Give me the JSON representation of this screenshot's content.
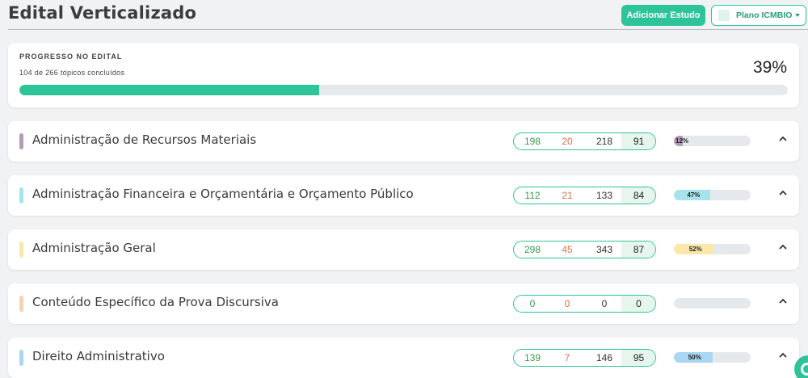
{
  "header": {
    "title": "Edital Verticalizado",
    "add_button": "Adicionar Estudo",
    "plan_button": "Plano ICMBIO"
  },
  "progress": {
    "label": "PROGRESSO NO EDITAL",
    "subtitle": "104 de 266 tópicos concluídos",
    "percent_text": "39%",
    "percent": 39,
    "bar_color": "#2ec49a"
  },
  "subjects": [
    {
      "name": "Administração de Recursos Materiais",
      "color": "#b49bb4",
      "correct": "198",
      "wrong": "20",
      "total": "218",
      "score": "91",
      "progress_text": "12%",
      "progress": 12,
      "bar_color": "#b49bb4"
    },
    {
      "name": "Administração Financeira e Orçamentária e Orçamento Público",
      "color": "#a6e3ec",
      "correct": "112",
      "wrong": "21",
      "total": "133",
      "score": "84",
      "progress_text": "47%",
      "progress": 47,
      "bar_color": "#a6e3ec"
    },
    {
      "name": "Administração Geral",
      "color": "#fbe7a9",
      "correct": "298",
      "wrong": "45",
      "total": "343",
      "score": "87",
      "progress_text": "52%",
      "progress": 52,
      "bar_color": "#fbe7a9"
    },
    {
      "name": "Conteúdo Específico da Prova Discursiva",
      "color": "#f3d2bd",
      "correct": "0",
      "wrong": "0",
      "total": "0",
      "score": "0",
      "progress_text": "",
      "progress": 0,
      "bar_color": "#f3d2bd"
    },
    {
      "name": "Direito Administrativo",
      "color": "#a8d6f3",
      "correct": "139",
      "wrong": "7",
      "total": "146",
      "score": "95",
      "progress_text": "50%",
      "progress": 50,
      "bar_color": "#a8d6f3"
    }
  ]
}
